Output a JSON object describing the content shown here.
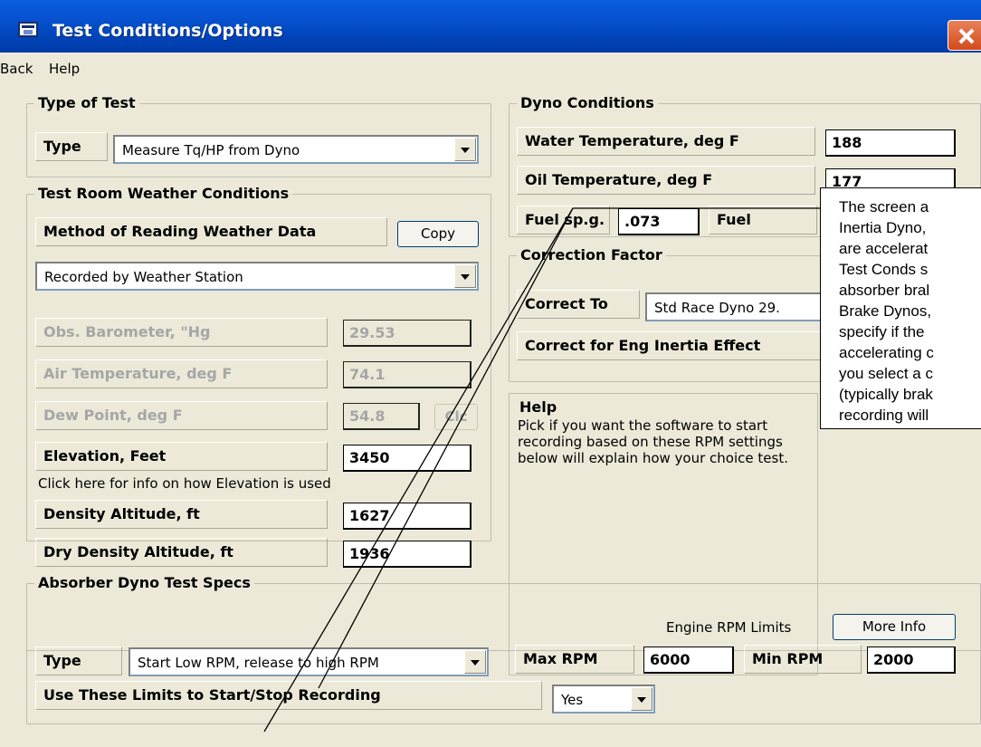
{
  "window": {
    "title": "Test Conditions/Options"
  },
  "menu": {
    "back": "Back",
    "help": "Help"
  },
  "type_of_test": {
    "legend": "Type of Test",
    "type_label": "Type",
    "type_value": "Measure Tq/HP from Dyno"
  },
  "weather": {
    "legend": "Test Room Weather Conditions",
    "method_label": "Method of Reading Weather Data",
    "copy_button": "Copy",
    "method_value": "Recorded by Weather Station",
    "barometer_label": "Obs. Barometer, \"Hg",
    "barometer_value": "29.53",
    "air_temp_label": "Air Temperature, deg F",
    "air_temp_value": "74.1",
    "dew_point_label": "Dew Point, deg F",
    "dew_point_value": "54.8",
    "calc_button": "Clc",
    "elevation_label": "Elevation, Feet",
    "elevation_value": "3450",
    "elevation_info": "Click here for info on how Elevation is used",
    "density_alt_label": "Density Altitude, ft",
    "density_alt_value": "1627",
    "dry_density_alt_label": "Dry Density Altitude, ft",
    "dry_density_alt_value": "1936"
  },
  "dyno_conditions": {
    "legend": "Dyno Conditions",
    "water_temp_label": "Water Temperature, deg F",
    "water_temp_value": "188",
    "oil_temp_label": "Oil Temperature, deg F",
    "oil_temp_value": "177",
    "fuel_spg_label": "Fuel sp.g.",
    "fuel_spg_value": ".073",
    "fuel_label": "Fuel"
  },
  "correction": {
    "legend": "Correction Factor",
    "correct_to_label": "Correct To",
    "correct_to_value": "Std Race Dyno 29.",
    "inertia_label": "Correct for Eng Inertia Effect"
  },
  "help": {
    "title": "Help",
    "body": "Pick if you want the software to start recording based on these RPM settings below will explain how your choice test."
  },
  "callout": {
    "text": "The screen a\nInertia Dyno,\nare accelerat\nTest Conds s\nabsorber bral\nBrake Dynos,\nspecify if the\naccelerating c\nyou select a c\n(typically brak\nrecording will\nRPM and enc"
  },
  "absorber": {
    "legend": "Absorber Dyno Test Specs",
    "rpm_limits_label": "Engine RPM Limits",
    "more_info_button": "More Info",
    "type_label": "Type",
    "type_value": "Start Low RPM, release to high RPM",
    "max_rpm_label": "Max RPM",
    "max_rpm_value": "6000",
    "min_rpm_label": "Min RPM",
    "min_rpm_value": "2000",
    "use_limits_label": "Use These Limits to Start/Stop Recording",
    "use_limits_value": "Yes"
  },
  "colors": {
    "titlebar": "#0055e5",
    "face": "#ece9d8",
    "close": "#e0603a"
  }
}
